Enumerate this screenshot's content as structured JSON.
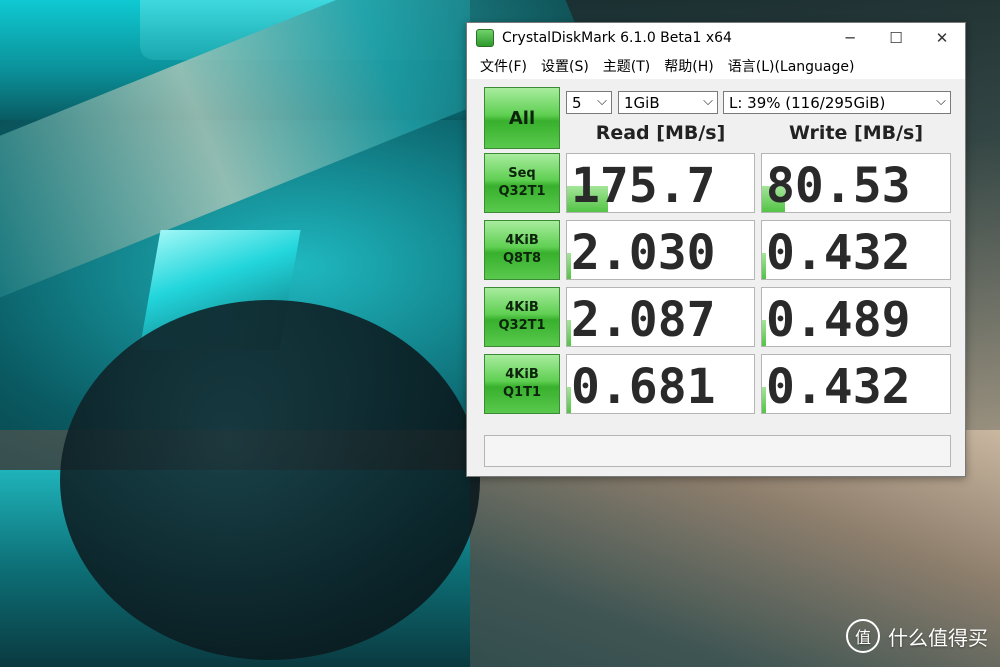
{
  "window": {
    "title": "CrystalDiskMark 6.1.0 Beta1 x64",
    "controls": {
      "minimize": "─",
      "maximize": "☐",
      "close": "✕"
    }
  },
  "menu": {
    "file": "文件(F)",
    "settings": "设置(S)",
    "theme": "主题(T)",
    "help": "帮助(H)",
    "language": "语言(L)(Language)"
  },
  "controls": {
    "all_label": "All",
    "count_value": "5",
    "size_value": "1GiB",
    "drive_value": "L: 39% (116/295GiB)",
    "dropdown_glyph": "⌵"
  },
  "headers": {
    "read": "Read [MB/s]",
    "write": "Write [MB/s]"
  },
  "tests": [
    {
      "line1": "Seq",
      "line2": "Q32T1",
      "read": "175.7",
      "write": "80.53",
      "read_fill": 0.22,
      "write_fill": 0.12
    },
    {
      "line1": "4KiB",
      "line2": "Q8T8",
      "read": "2.030",
      "write": "0.432",
      "read_fill": 0.02,
      "write_fill": 0.02
    },
    {
      "line1": "4KiB",
      "line2": "Q32T1",
      "read": "2.087",
      "write": "0.489",
      "read_fill": 0.02,
      "write_fill": 0.02
    },
    {
      "line1": "4KiB",
      "line2": "Q1T1",
      "read": "0.681",
      "write": "0.432",
      "read_fill": 0.01,
      "write_fill": 0.02
    }
  ],
  "comment": "",
  "watermark": {
    "text": "什么值得买",
    "icon": "值"
  },
  "colors": {
    "accent_green": "#52c445",
    "window_bg": "#f0f0f0"
  }
}
